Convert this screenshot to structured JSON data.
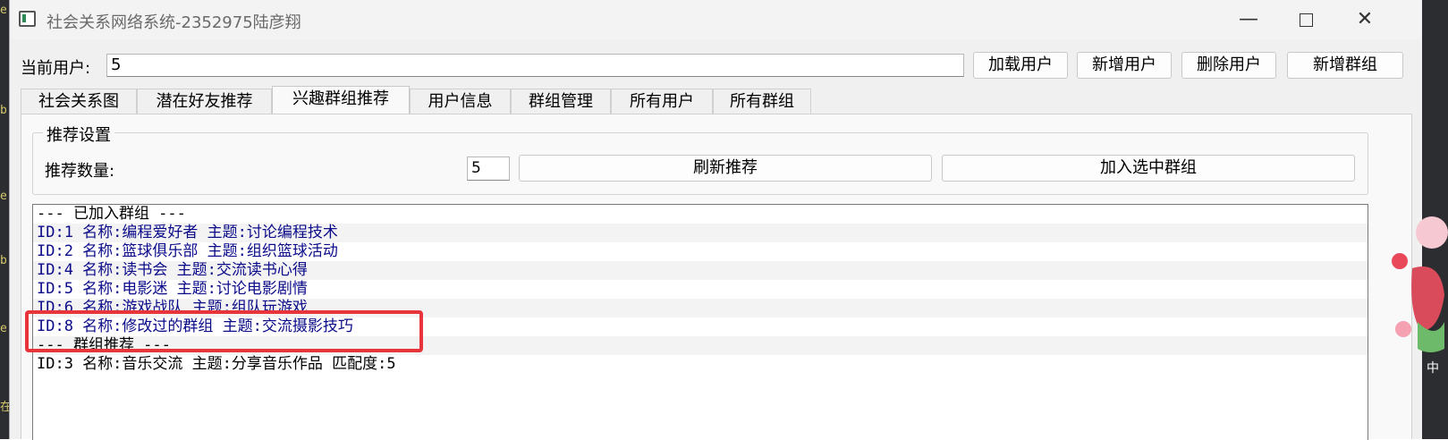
{
  "window": {
    "title": "社会关系网络系统-2352975陆彦翔",
    "minimize_glyph": "—",
    "close_glyph": "✕"
  },
  "header": {
    "current_user_label": "当前用户:",
    "current_user_value": "5",
    "buttons": {
      "load_user": "加载用户",
      "add_user": "新增用户",
      "delete_user": "删除用户",
      "add_group": "新增群组"
    }
  },
  "tabs": [
    {
      "label": "社会关系图"
    },
    {
      "label": "潜在好友推荐"
    },
    {
      "label": "兴趣群组推荐",
      "active": true
    },
    {
      "label": "用户信息"
    },
    {
      "label": "群组管理"
    },
    {
      "label": "所有用户"
    },
    {
      "label": "所有群组"
    }
  ],
  "settings": {
    "group_title": "推荐设置",
    "count_label": "推荐数量:",
    "count_value": "5",
    "refresh_button": "刷新推荐",
    "join_button": "加入选中群组"
  },
  "list": {
    "rows": [
      "--- 已加入群组 ---",
      "ID:1 名称:编程爱好者 主题:讨论编程技术",
      "ID:2 名称:篮球俱乐部 主题:组织篮球活动",
      "ID:4 名称:读书会 主题:交流读书心得",
      "ID:5 名称:电影迷 主题:讨论电影剧情",
      "ID:6 名称:游戏战队 主题:组队玩游戏",
      "ID:8 名称:修改过的群组 主题:交流摄影技巧",
      "--- 群组推荐 ---",
      "ID:3 名称:音乐交流 主题:分享音乐作品 匹配度:5"
    ]
  },
  "colors": {
    "joined_text": "#0b0b8a",
    "highlight_border": "#e8343b"
  }
}
